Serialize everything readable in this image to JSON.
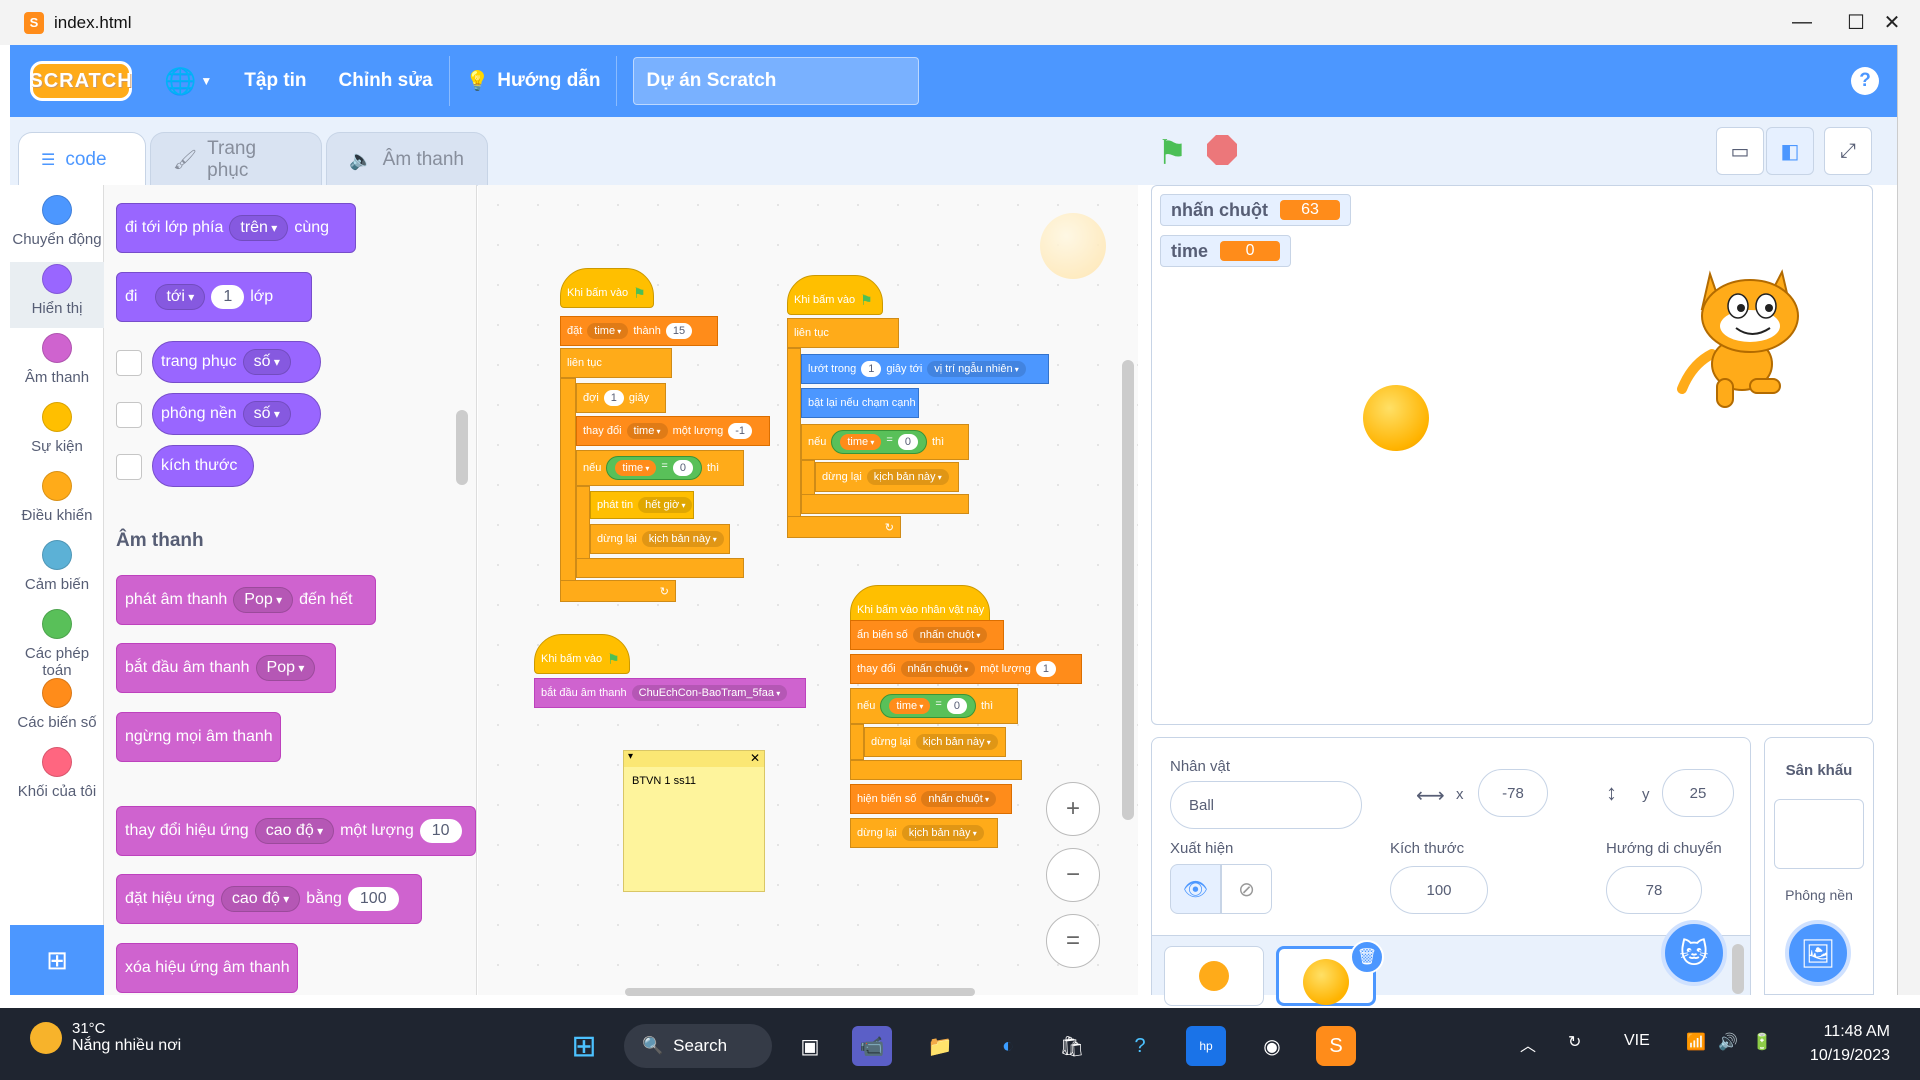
{
  "window": {
    "title": "index.html"
  },
  "menubar": {
    "logo": "SCRATCH",
    "file": "Tập tin",
    "edit": "Chỉnh sửa",
    "tutorial": "Hướng dẫn",
    "project_title": "Dự án Scratch",
    "help": "?"
  },
  "tabs": {
    "code": "code",
    "costumes": "Trang phục",
    "sounds": "Âm thanh"
  },
  "categories": [
    {
      "label": "Chuyển động",
      "color": "#4c97ff"
    },
    {
      "label": "Hiển thị",
      "color": "#9966ff"
    },
    {
      "label": "Âm thanh",
      "color": "#cf63cf"
    },
    {
      "label": "Sự kiện",
      "color": "#ffbf00"
    },
    {
      "label": "Điều khiển",
      "color": "#ffab19"
    },
    {
      "label": "Cảm biến",
      "color": "#5cb1d6"
    },
    {
      "label": "Các phép toán",
      "color": "#59c059"
    },
    {
      "label": "Các biến số",
      "color": "#ff8c1a"
    },
    {
      "label": "Khối của tôi",
      "color": "#ff6680"
    }
  ],
  "palette": {
    "b1": {
      "a": "đi tới lớp phía",
      "d": "trên",
      "b": "cùng"
    },
    "b2": {
      "a": "đi",
      "d": "tới",
      "n": "1",
      "b": "lớp"
    },
    "b3": {
      "a": "trang phục",
      "d": "số"
    },
    "b4": {
      "a": "phông nền",
      "d": "số"
    },
    "b5": {
      "a": "kích thước"
    },
    "sound_head": "Âm thanh",
    "s1": {
      "a": "phát âm thanh",
      "d": "Pop",
      "b": "đến hết"
    },
    "s2": {
      "a": "bắt đầu âm thanh",
      "d": "Pop"
    },
    "s3": {
      "a": "ngừng mọi âm thanh"
    },
    "s4": {
      "a": "thay đổi hiệu ứng",
      "d": "cao độ",
      "b": "một lượng",
      "n": "10"
    },
    "s5": {
      "a": "đặt hiệu ứng",
      "d": "cao độ",
      "b": "bằng",
      "n": "100"
    },
    "s6": {
      "a": "xóa hiệu ứng âm thanh"
    }
  },
  "script1": {
    "hat": "Khi bấm vào",
    "set": "đặt",
    "set_var": "time",
    "set_to": "thành",
    "set_val": "15",
    "forever": "liên tục",
    "wait": "đợi",
    "wait_val": "1",
    "wait_unit": "giây",
    "change": "thay đổi",
    "change_var": "time",
    "change_by": "một lượng",
    "change_val": "-1",
    "if": "nếu",
    "cmp_var": "time",
    "cmp_op": "=",
    "cmp_val": "0",
    "then": "thì",
    "broadcast": "phát tin",
    "broadcast_msg": "hết giờ",
    "stop": "dừng lại",
    "stop_opt": "kịch bản này",
    "arrow": "↻"
  },
  "script2": {
    "hat": "Khi bấm vào",
    "forever": "liên tục",
    "glide": "lướt trong",
    "glide_val": "1",
    "glide_to": "giây tới",
    "glide_target": "vị trí ngẫu nhiên",
    "bounce": "bật lại nếu chạm cạnh",
    "if": "nếu",
    "cmp_var": "time",
    "cmp_op": "=",
    "cmp_val": "0",
    "then": "thì",
    "stop": "dừng lại",
    "stop_opt": "kịch bản này",
    "arrow": "↻"
  },
  "script3": {
    "hat": "Khi bấm vào",
    "play": "bắt đầu âm thanh",
    "play_sound": "ChuEchCon-BaoTram_5faa"
  },
  "script4": {
    "hat": "Khi bấm vào nhân vật này",
    "hide": "ẩn biến số",
    "hide_var": "nhấn chuột",
    "change": "thay đổi",
    "change_var": "nhấn chuột",
    "change_by": "một lượng",
    "change_val": "1",
    "if": "nếu",
    "cmp_var": "time",
    "cmp_op": "=",
    "cmp_val": "0",
    "then": "thì",
    "stop": "dừng lại",
    "stop_opt": "kịch bản này",
    "show": "hiện biến số",
    "show_var": "nhấn chuột",
    "stop2": "dừng lại",
    "stop2_opt": "kịch bản này"
  },
  "note": {
    "text": "BTVN 1 ss11"
  },
  "zoom": {
    "in": "+",
    "out": "−",
    "reset": "="
  },
  "stage": {
    "monitors": [
      {
        "name": "nhấn chuột",
        "value": "63"
      },
      {
        "name": "time",
        "value": "0"
      }
    ]
  },
  "sprite_info": {
    "label_sprite": "Nhân vật",
    "sprite_name": "Ball",
    "x_label": "x",
    "x": "-78",
    "y_label": "y",
    "y": "25",
    "label_show": "Xuất hiện",
    "label_size": "Kích thước",
    "size": "100",
    "label_direction": "Hướng di chuyển",
    "direction": "78"
  },
  "stage_pane": {
    "title": "Sân khấu",
    "backdrops": "Phông nền"
  },
  "taskbar": {
    "temp": "31°C",
    "weather": "Nắng nhiều nơi",
    "search": "Search",
    "lang": "VIE",
    "time": "11:48 AM",
    "date": "10/19/2023"
  }
}
